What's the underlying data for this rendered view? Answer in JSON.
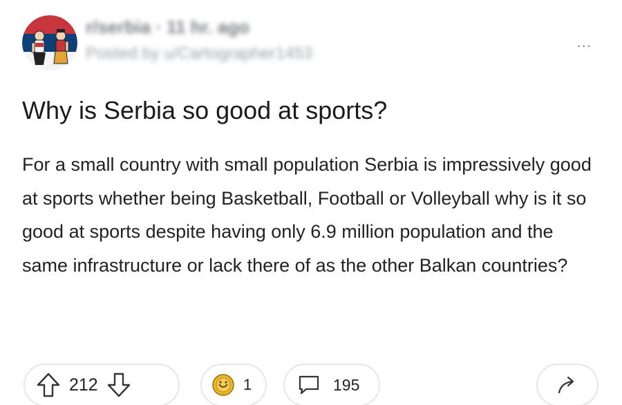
{
  "header": {
    "username": "r/serbia · 11 hr. ago",
    "posted_by": "Posted by u/Cartographer1453",
    "more_label": "..."
  },
  "post": {
    "title": "Why is Serbia so good at sports?",
    "body": "For a small country with small population Serbia is impressively good at sports whether being Basketball, Football or Volleyball why is it so good at sports despite having only 6.9 million population and the same infrastructure or lack there of as the other Balkan countries?"
  },
  "actions": {
    "upvotes": "212",
    "awards": "1",
    "comments": "195"
  },
  "icons": {
    "upvote": "upvote-arrow-icon",
    "downvote": "downvote-arrow-icon",
    "award": "award-medal-icon",
    "comment": "comment-bubble-icon",
    "share": "share-arrow-icon",
    "more": "more-dots-icon"
  },
  "colors": {
    "flag_red": "#c6363c",
    "flag_blue": "#0c4076",
    "award_gold": "#e8b52b",
    "border": "#e4e6e8"
  }
}
